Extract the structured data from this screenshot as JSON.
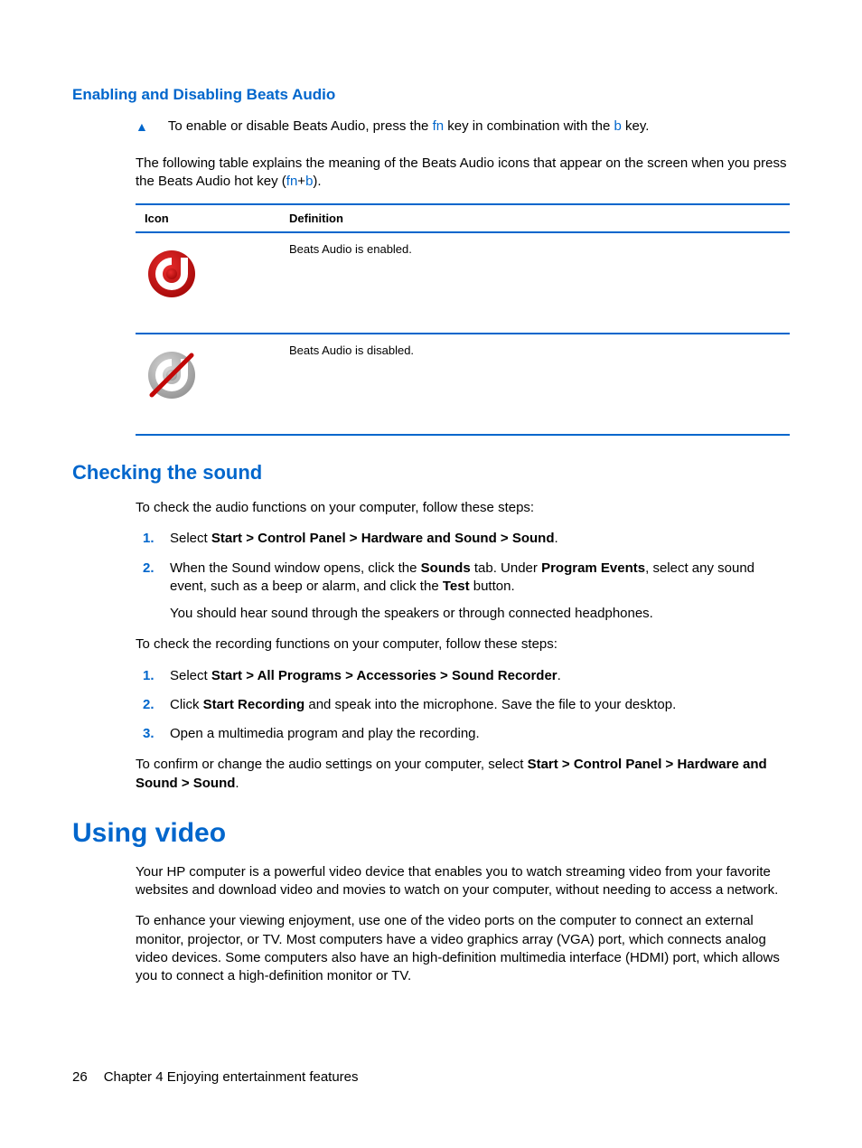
{
  "section1": {
    "heading": "Enabling and Disabling Beats Audio",
    "instruction_pre": "To enable or disable Beats Audio, press the ",
    "key1": "fn",
    "instruction_mid": " key in combination with the ",
    "key2": "b",
    "instruction_post": " key.",
    "para2_pre": "The following table explains the meaning of the Beats Audio icons that appear on the screen when you press the Beats Audio hot key (",
    "para2_k1": "fn",
    "para2_plus": "+",
    "para2_k2": "b",
    "para2_post": ").",
    "table": {
      "col1": "Icon",
      "col2": "Definition",
      "row1def": "Beats Audio is enabled.",
      "row2def": "Beats Audio is disabled."
    }
  },
  "section2": {
    "heading": "Checking the sound",
    "intro": "To check the audio functions on your computer, follow these steps:",
    "step1_pre": "Select ",
    "step1_bold": "Start > Control Panel > Hardware and Sound > Sound",
    "step1_post": ".",
    "step2_a": "When the Sound window opens, click the ",
    "step2_b": "Sounds",
    "step2_c": " tab. Under ",
    "step2_d": "Program Events",
    "step2_e": ", select any sound event, such as a beep or alarm, and click the ",
    "step2_f": "Test",
    "step2_g": " button.",
    "step2_sub": "You should hear sound through the speakers or through connected headphones.",
    "intro2": "To check the recording functions on your computer, follow these steps:",
    "rec1_pre": "Select ",
    "rec1_bold": "Start > All Programs > Accessories > Sound Recorder",
    "rec1_post": ".",
    "rec2_pre": "Click ",
    "rec2_bold": "Start Recording",
    "rec2_post": " and speak into the microphone. Save the file to your desktop.",
    "rec3": "Open a multimedia program and play the recording.",
    "confirm_pre": "To confirm or change the audio settings on your computer, select ",
    "confirm_bold": "Start > Control Panel > Hardware and Sound > Sound",
    "confirm_post": "."
  },
  "section3": {
    "heading": "Using video",
    "para1": "Your HP computer is a powerful video device that enables you to watch streaming video from your favorite websites and download video and movies to watch on your computer, without needing to access a network.",
    "para2": "To enhance your viewing enjoyment, use one of the video ports on the computer to connect an external monitor, projector, or TV. Most computers have a video graphics array (VGA) port, which connects analog video devices. Some computers also have an high-definition multimedia interface (HDMI) port, which allows you to connect a high-definition monitor or TV."
  },
  "footer": {
    "pagenum": "26",
    "chapter": "Chapter 4   Enjoying entertainment features"
  }
}
